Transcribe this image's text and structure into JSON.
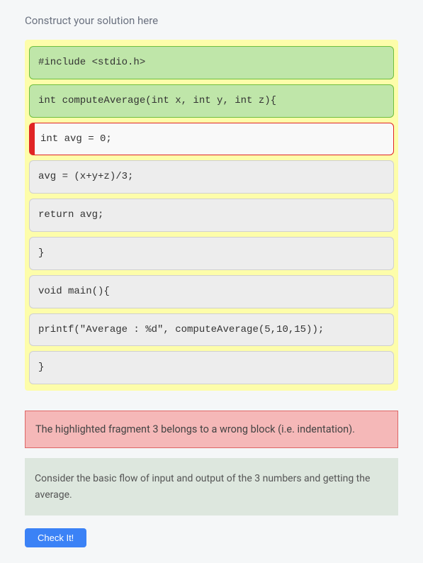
{
  "instruction": "Construct your solution here",
  "blocks": [
    {
      "code": "#include <stdio.h>",
      "style": "green"
    },
    {
      "code": "int computeAverage(int x, int y, int z){",
      "style": "green"
    },
    {
      "code": "int avg = 0;",
      "style": "wrong"
    },
    {
      "code": "avg = (x+y+z)/3;",
      "style": "grey"
    },
    {
      "code": "return avg;",
      "style": "grey"
    },
    {
      "code": "}",
      "style": "grey"
    },
    {
      "code": "void main(){",
      "style": "grey"
    },
    {
      "code": "printf(\"Average : %d\", computeAverage(5,10,15));",
      "style": "grey"
    },
    {
      "code": "}",
      "style": "grey"
    }
  ],
  "error_message": "The highlighted fragment 3 belongs to a wrong block (i.e. indentation).",
  "hint_message": "Consider the basic flow of input and output of the 3 numbers and getting the average.",
  "check_button_label": "Check It!"
}
